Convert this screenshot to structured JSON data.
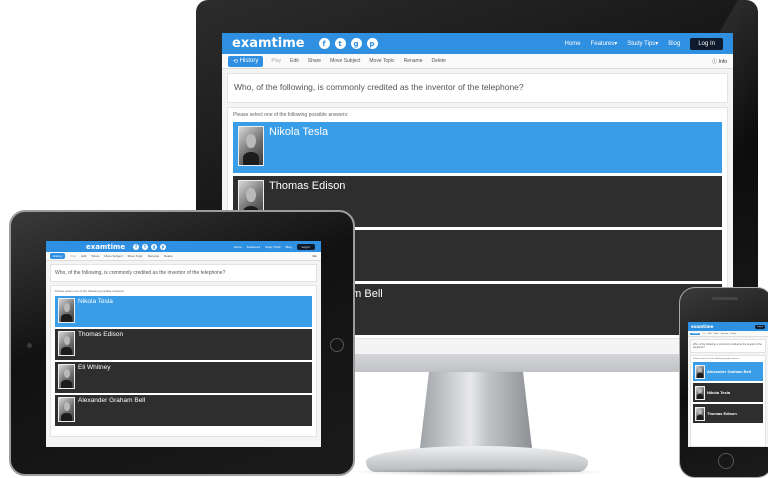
{
  "app": {
    "logo": "examtime",
    "social_icons": [
      "facebook-icon",
      "twitter-icon",
      "google-plus-icon",
      "pinterest-icon"
    ],
    "social_glyphs": [
      "f",
      "t",
      "g",
      "p"
    ],
    "nav_links": [
      "Home",
      "Features▾",
      "Study Tips▾",
      "Blog"
    ],
    "login_label": "Log In",
    "accent_color": "#2f8fe0"
  },
  "toolbar": {
    "history_label": "History",
    "play_label": "Play",
    "edit_label": "Edit",
    "share_label": "Share",
    "move_subject_label": "Move Subject",
    "move_topic_label": "Move Topic",
    "rename_label": "Rename",
    "delete_label": "Delete",
    "info_label": "Info"
  },
  "quiz": {
    "question": "Who, of the following, is commonly credited as the inventor of the telephone?",
    "prompt": "Please select one of the following possible answers:",
    "answers": [
      "Nikola Tesla",
      "Thomas Edison",
      "Eli Whitney",
      "Alexander Graham Bell"
    ],
    "selected_answer": "Nikola Tesla"
  }
}
